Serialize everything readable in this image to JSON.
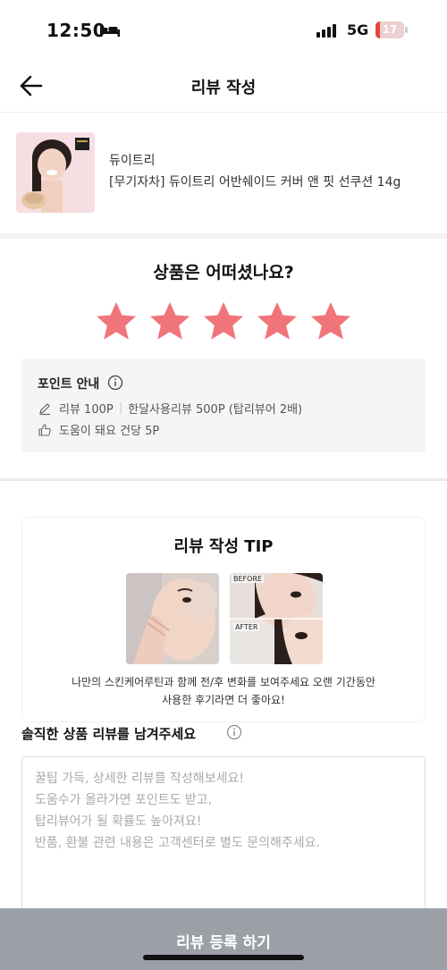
{
  "status_bar": {
    "time": "12:50",
    "network": "5G",
    "battery_level": "17",
    "battery_fraction": 0.17,
    "battery_color": "#e0463c"
  },
  "header": {
    "title": "리뷰 작성",
    "back_icon": "arrow-left-icon"
  },
  "product": {
    "brand": "듀이트리",
    "name": "[무기자차] 듀이트리 어반쉐이드 커버 앤 핏 선쿠션 14g"
  },
  "rating": {
    "question": "상품은 어떠셨나요?",
    "stars_selected": 5,
    "stars_total": 5,
    "star_color": "#f0757a"
  },
  "points": {
    "title": "포인트 안내",
    "review_reward": "리뷰 100P",
    "month_reward": "한달사용리뷰 500P (탑리뷰어 2배)",
    "helpful_reward": "도움이 돼요 건당 5P"
  },
  "tip": {
    "title": "리뷰 작성 TIP",
    "before_label": "BEFORE",
    "after_label": "AFTER",
    "description_line1": "나만의 스킨케어루틴과 함께 전/후 변화를 보여주세요 오랜 기간동안",
    "description_line2": "사용한 후기라면 더 좋아요!"
  },
  "review": {
    "label": "솔직한 상품 리뷰를 남겨주세요",
    "placeholder_line1": "꿀팁 가득, 상세한 리뷰를 작성해보세요!",
    "placeholder_line2": "도움수가 올라가면 포인트도 받고,",
    "placeholder_line3": "탑리뷰어가 될 확률도 높아져요!",
    "placeholder_line4": "반품, 환불 관련 내용은 고객센터로 별도 문의해주세요."
  },
  "submit": {
    "label": "리뷰 등록 하기",
    "color": "#9aa0a6"
  }
}
